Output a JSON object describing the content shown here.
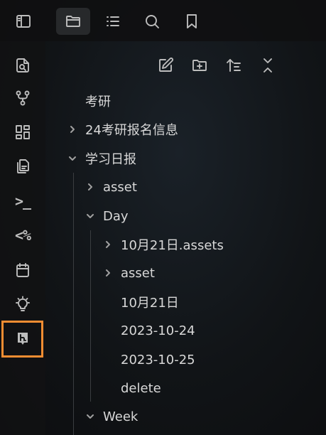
{
  "vault": {
    "title": "考研"
  },
  "tree": {
    "item_1": "24考研报名信息",
    "item_2": "学习日报",
    "item_3": "asset",
    "item_4": "Day",
    "item_5": "10月21日.assets",
    "item_6": "asset",
    "item_7": "10月21日",
    "item_8": "2023-10-24",
    "item_9": "2023-10-25",
    "item_10": "delete",
    "item_11": "Week"
  },
  "ribbon": {
    "terminal_label": ">_",
    "templater_label": "<%"
  },
  "colors": {
    "highlight": "#f38d32",
    "background": "#111417",
    "text": "#d8d8d8"
  },
  "icons": {
    "top": [
      "sidebar-toggle-icon",
      "folder-icon",
      "list-icon",
      "search-icon",
      "bookmark-icon"
    ],
    "ribbon": [
      "file-search-icon",
      "graph-icon",
      "dashboard-icon",
      "copy-icon",
      "terminal-icon",
      "templater-icon",
      "calendar-icon",
      "lightbulb-icon",
      "hypothesis-icon"
    ],
    "toolbar": [
      "new-note-icon",
      "new-folder-icon",
      "sort-icon",
      "collapse-all-icon"
    ]
  }
}
